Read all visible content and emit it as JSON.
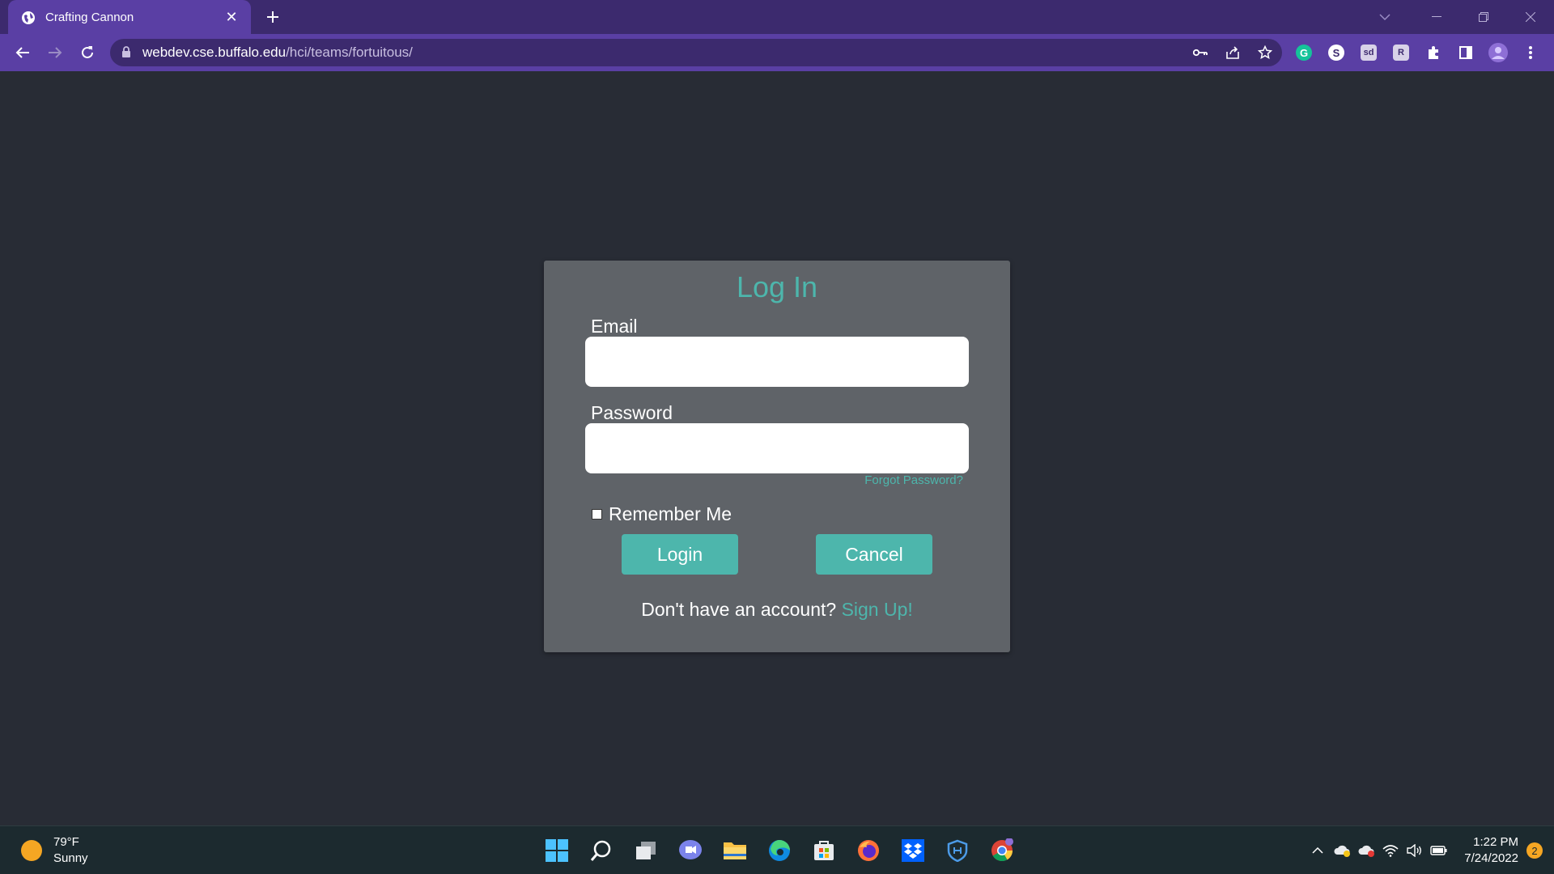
{
  "browser": {
    "tab": {
      "title": "Crafting Cannon"
    },
    "url": {
      "host": "webdev.cse.buffalo.edu",
      "path": "/hci/teams/fortuitous/"
    },
    "accent_color": "#5a3fa4"
  },
  "login": {
    "title": "Log In",
    "email_label": "Email",
    "email_value": "",
    "password_label": "Password",
    "password_value": "",
    "forgot_password": "Forgot Password?",
    "remember_me": "Remember Me",
    "login_button": "Login",
    "cancel_button": "Cancel",
    "signup_prompt": "Don't have an account?",
    "signup_link": "Sign Up!",
    "accent_color": "#4db6ac"
  },
  "taskbar": {
    "weather": {
      "temp": "79°F",
      "condition": "Sunny"
    },
    "apps": [
      "windows-start-icon",
      "search-icon",
      "task-view-icon",
      "chat-icon",
      "file-explorer-icon",
      "edge-icon",
      "store-icon",
      "firefox-icon",
      "dropbox-icon",
      "shield-app-icon",
      "chrome-icon"
    ],
    "clock": {
      "time": "1:22 PM",
      "date": "7/24/2022"
    },
    "notifications": "2"
  }
}
